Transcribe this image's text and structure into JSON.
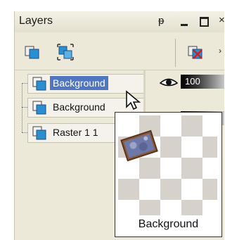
{
  "palette": {
    "title": "Layers",
    "controls": {
      "pin": "ᵽ",
      "close": "×"
    }
  },
  "toolbar": {
    "buttons": [
      "new-layer-icon",
      "group-layers-icon",
      "delete-layer-icon"
    ]
  },
  "layers": [
    {
      "name": "Background",
      "selected": true,
      "opacity": "100",
      "visible": true
    },
    {
      "name": "Background",
      "selected": false,
      "opacity": "100",
      "visible": true
    },
    {
      "name": "Raster 1 1",
      "selected": false
    }
  ],
  "tooltip": {
    "caption": "Background"
  },
  "colors": {
    "selection": "#5076c0",
    "panel": "#ece9d8",
    "icon_blue": "#2a8fd0"
  }
}
